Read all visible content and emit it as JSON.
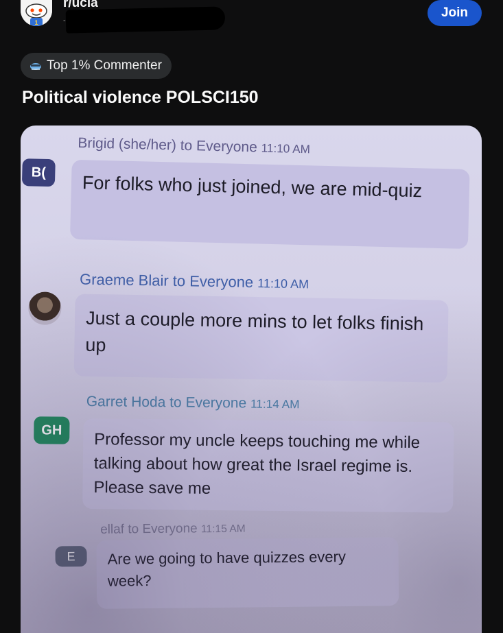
{
  "header": {
    "subreddit": "r/ucla",
    "meta": "-- ··",
    "join_label": "Join",
    "join_color": "#1a55cc"
  },
  "flair": {
    "icon": "sparkle-icon",
    "label": "Top 1% Commenter"
  },
  "post": {
    "title": "Political violence POLSCI150"
  },
  "chat": {
    "bubble_color": "#c5c0e2",
    "messages": [
      {
        "initials": "B(",
        "avatar": "initials",
        "name_line": "Brigid (she/her) to Everyone",
        "time": "11:10 AM",
        "text": "For folks who just joined, we are mid-quiz"
      },
      {
        "initials": "",
        "avatar": "photo-icon",
        "name_line": "Graeme Blair to Everyone",
        "time": "11:10 AM",
        "text": "Just a couple more mins to let folks finish up"
      },
      {
        "initials": "GH",
        "avatar": "initials",
        "name_line": "Garret Hoda to Everyone",
        "time": "11:14 AM",
        "text": "Professor my uncle keeps touching me while talking about how great the Israel regime is. Please save me"
      },
      {
        "initials": "E",
        "avatar": "initials",
        "name_line": "ellaf to Everyone",
        "time": "11:15 AM",
        "text": "Are we going to have quizzes every week?"
      }
    ]
  }
}
